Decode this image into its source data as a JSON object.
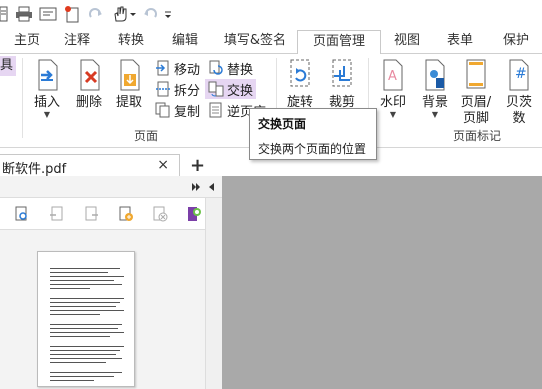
{
  "qat": {
    "icons": [
      "sidebar-icon",
      "print-icon",
      "email-icon",
      "new-icon",
      "redo-icon",
      "hand-tool-icon",
      "undo-icon",
      "customize-icon"
    ]
  },
  "tabs": [
    {
      "label": "主页"
    },
    {
      "label": "注释"
    },
    {
      "label": "转换"
    },
    {
      "label": "编辑"
    },
    {
      "label": "填写&签名"
    },
    {
      "label": "页面管理"
    },
    {
      "label": "视图"
    },
    {
      "label": "表单"
    },
    {
      "label": "保护"
    }
  ],
  "ribbon": {
    "tools_partial": "具",
    "insert": "插入",
    "delete": "删除",
    "extract": "提取",
    "move": "移动",
    "split": "拆分",
    "copy": "复制",
    "replace": "替换",
    "swap": "交换",
    "reverse": "逆页序",
    "rotate": "旋转",
    "crop": "裁剪",
    "watermark": "水印",
    "background": "背景",
    "header_line1": "页眉/",
    "header_line2": "页脚",
    "bates_line1": "贝茨",
    "bates_line2": "数",
    "group_pages": "页面",
    "group_marks": "页面标记"
  },
  "tooltip": {
    "title": "交换页面",
    "desc": "交换两个页面的位置"
  },
  "doctab": {
    "name": "断软件.pdf",
    "close": "×",
    "add": "+"
  },
  "colors": {
    "accent": "#7b3fa8",
    "highlight": "#e6d6f2",
    "mainview": "#a9a9a9"
  }
}
